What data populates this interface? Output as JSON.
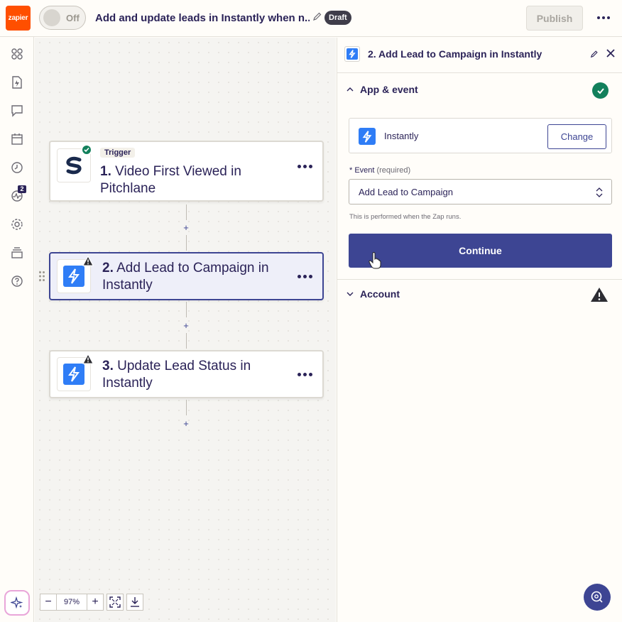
{
  "header": {
    "logo_text": "zapier",
    "toggle_label": "Off",
    "zap_title": "Add and update leads in Instantly when n...",
    "draft_badge": "Draft",
    "publish_label": "Publish"
  },
  "sidebar": {
    "items": [
      {
        "icon": "apps-icon"
      },
      {
        "icon": "zap-file-icon"
      },
      {
        "icon": "comment-icon"
      },
      {
        "icon": "calendar-icon"
      },
      {
        "icon": "history-icon"
      },
      {
        "icon": "activity-icon",
        "badge": "2"
      },
      {
        "icon": "settings-icon"
      },
      {
        "icon": "layers-icon"
      },
      {
        "icon": "help-icon"
      }
    ]
  },
  "canvas": {
    "steps": [
      {
        "number": "1.",
        "title": "Video First Viewed in Pitchlane",
        "badge": "Trigger",
        "app": "Pitchlane",
        "status": "complete"
      },
      {
        "number": "2.",
        "title": "Add Lead to Campaign in Instantly",
        "app": "Instantly",
        "status": "warning",
        "selected": true
      },
      {
        "number": "3.",
        "title": "Update Lead Status in Instantly",
        "app": "Instantly",
        "status": "warning"
      }
    ],
    "plus": "+",
    "zoom": {
      "minus": "−",
      "level": "97%",
      "plus": "+"
    }
  },
  "panel": {
    "title": "2. Add Lead to Campaign in Instantly",
    "app_event_section": {
      "label": "App & event",
      "app_name": "Instantly",
      "change_label": "Change",
      "event_label": "Event",
      "event_required": "(required)",
      "event_value": "Add Lead to Campaign",
      "helper_text": "This is performed when the Zap runs.",
      "continue_label": "Continue"
    },
    "account_section": {
      "label": "Account"
    }
  },
  "colors": {
    "brand": "#ff4f00",
    "primary": "#3d4593",
    "success": "#12805c",
    "instantly": "#2f7df6"
  }
}
